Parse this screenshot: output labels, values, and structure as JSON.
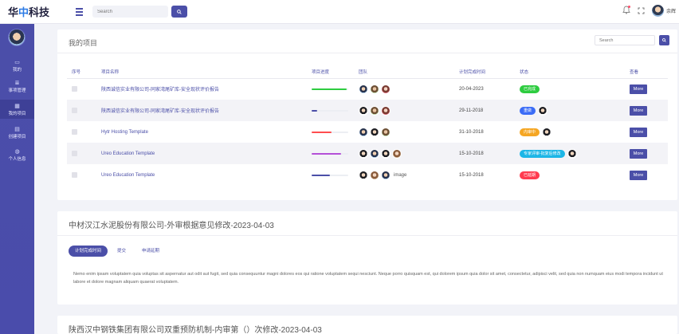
{
  "header": {
    "logo_text": "华中科技",
    "search_placeholder": "Search",
    "username": "余辉"
  },
  "sidebar": {
    "items": [
      {
        "label": "我的",
        "icon": "monitor-icon"
      },
      {
        "label": "事项管理",
        "icon": "list-icon"
      },
      {
        "label": "我的项目",
        "icon": "grid-icon",
        "active": true
      },
      {
        "label": "创建项目",
        "icon": "document-icon"
      },
      {
        "label": "个人信息",
        "icon": "user-icon"
      }
    ]
  },
  "projects": {
    "title": "我的项目",
    "search_placeholder": "Search",
    "columns": [
      "序号",
      "项目名称",
      "项目进度",
      "团队",
      "计划完成时间",
      "状态",
      "查看"
    ],
    "rows": [
      {
        "name": "陕西诚信实业有限公司-同家湾尾矿库-安全现状评价报告",
        "progress": 0.95,
        "progress_color": "#2ecc40",
        "team": [
          "a1",
          "a2",
          "a3"
        ],
        "team_extra": "",
        "date": "20-04-2023",
        "badges": [
          {
            "text": "已完成",
            "color": "#2ecc40"
          }
        ],
        "extra_avatar": false,
        "action": "More"
      },
      {
        "name": "陕西诚信实业有限公司-同家湾尾矿库-安全现状评价报告",
        "progress": 0.15,
        "progress_color": "#4b4fa8",
        "team": [
          "a4",
          "a2",
          "a3"
        ],
        "team_extra": "",
        "date": "29-11-2018",
        "badges": [
          {
            "text": "重做",
            "color": "#3b6cf6"
          }
        ],
        "extra_avatar": true,
        "action": "More"
      },
      {
        "name": "Hytr Hosting Template",
        "progress": 0.55,
        "progress_color": "#ff4d4f",
        "team": [
          "a1",
          "a4",
          "a2"
        ],
        "team_extra": "",
        "date": "31-10-2018",
        "badges": [
          {
            "text": "内审中",
            "color": "#f5a623"
          }
        ],
        "extra_avatar": true,
        "action": "More"
      },
      {
        "name": "Ureo Education Template",
        "progress": 0.8,
        "progress_color": "#b44fd8",
        "team": [
          "a4",
          "a1",
          "a4",
          "a5"
        ],
        "team_extra": "",
        "date": "15-10-2018",
        "badges": [
          {
            "text": "专家评审-批复后修改",
            "color": "#1db6e6"
          }
        ],
        "extra_avatar": true,
        "action": "More"
      },
      {
        "name": "Ureo Education Template",
        "progress": 0.5,
        "progress_color": "#4b4fa8",
        "team": [
          "a4",
          "a5",
          "a1"
        ],
        "team_extra": "image",
        "date": "15-10-2018",
        "badges": [
          {
            "text": "已延期",
            "color": "#ff3b4f"
          }
        ],
        "extra_avatar": false,
        "action": "More"
      }
    ]
  },
  "detail1": {
    "title": "中材汉江水泥股份有限公司-外审根据意见修改-2023-04-03",
    "tabs": [
      "计划完成时间",
      "提交",
      "申请延期"
    ],
    "active_tab": 0,
    "text": "Nemo enim ipsam voluptatem quia voluptas sit aspernatur aut odit aut fugit, sed quia consequuntur magni dolores eos qui ratione voluptatem sequi nesciunt. Neque porro quisquam est, qui dolorem ipsum quia dolor sit amet, consectetur, adipisci velit, sed quia non numquam eius modi tempora incidunt ut labore et dolore magnam aliquam quaerat voluptatem."
  },
  "detail2": {
    "title": "陕西汉中钢铁集团有限公司双重预防机制-内审第（）次修改-2023-04-03"
  }
}
